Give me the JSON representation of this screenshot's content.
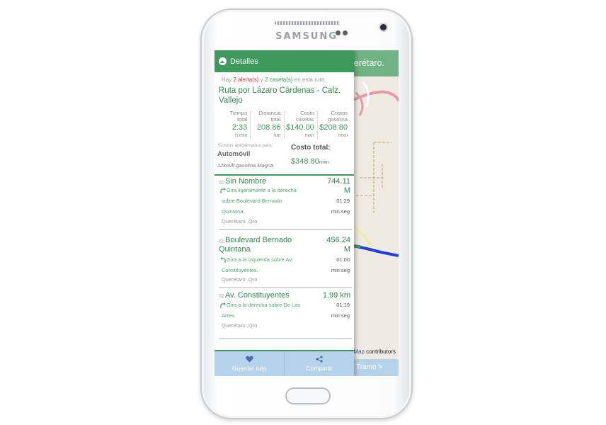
{
  "device": {
    "brand": "SAMSUNG"
  },
  "map": {
    "header_text": "uerétaro.",
    "attribution_link": "Map",
    "attribution_text": "contributors",
    "next_button_label": "Tramo >"
  },
  "panel": {
    "title": "Detalles",
    "alerts": {
      "prefix": "Hay",
      "alerts_text": "2 alerta(s)",
      "and": "y",
      "tolls_text": "2 caseta(s)",
      "suffix": "en esta ruta."
    },
    "route_title": "Ruta por Lázaro Cárdenas - Calz. Vallejo",
    "metrics": [
      {
        "label_line1": "Tiempo",
        "label_line2": "total",
        "value": "2:33",
        "unit": "h:min"
      },
      {
        "label_line1": "Distancia",
        "label_line2": "total",
        "value": "208.86",
        "unit": "km"
      },
      {
        "label_line1": "Costo",
        "label_line2": "casetas",
        "value": "$140.00",
        "unit": "mxn"
      },
      {
        "label_line1": "Costos",
        "label_line2": "gasolina",
        "value": "$208.80",
        "unit": "mxn"
      }
    ],
    "approx_note": "*Costos aproximados para:",
    "vehicle": "Automóvil",
    "fuel": "12km/lt gasolina Magna",
    "total_label": "Costo total:",
    "total_value": "$348.80",
    "total_unit": "mxn"
  },
  "steps": [
    {
      "number": "60",
      "name": "Sin Nombre",
      "distance_value": "744.11",
      "distance_unit": "M",
      "icon": "turn-right-icon",
      "instruction_line1": "Gira ligeramente a la derecha",
      "instruction_line2": "sobre Boulevard Bernado",
      "instruction_line3": "Quintana.",
      "time": "01:29",
      "time_unit": "min:seg",
      "city": "Querétaro ,Qro"
    },
    {
      "number": "61",
      "name_line1": "Boulevard Bernado",
      "name_line2": "Quintana",
      "distance_value": "456.24",
      "distance_unit": "M",
      "icon": "turn-left-icon",
      "instruction_line1": "Gira a la izquierda sobre Av.",
      "instruction_line2": "Constituyentes.",
      "time": "01:00",
      "time_unit": "min:seg",
      "city": "Querétaro ,Qro"
    },
    {
      "number": "62",
      "name": "Av. Constituyentes",
      "distance_value": "1.99 km",
      "icon": "turn-right-icon",
      "instruction_line1": "Gira a la derecha sobre De Las",
      "instruction_line2": "Artes.",
      "time": "01:19",
      "time_unit": "min:seg",
      "city": "Querétaro ,Qro"
    }
  ],
  "actions": {
    "save_label": "Guardar ruta",
    "share_label": "Compartir"
  },
  "colors": {
    "primary_green": "#3d9a5c",
    "alert_red": "#d8343f",
    "bottom_bar_blue": "#b6d3ec",
    "route_blue": "#1f3fd9"
  }
}
